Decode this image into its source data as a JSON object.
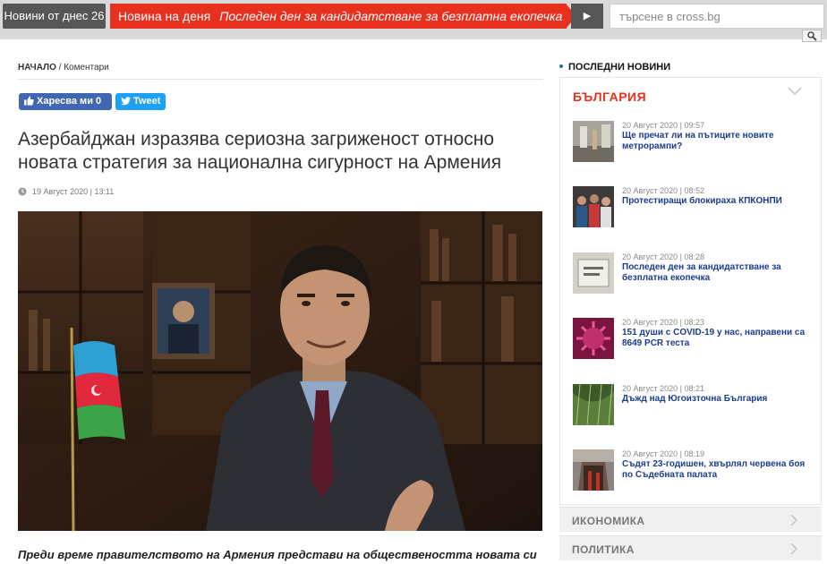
{
  "topbar": {
    "today_label": "Новини от днес 26",
    "news_day_label": "Новина на деня",
    "news_day_headline": "Последен ден за кандидатстване за безплатна екопечка",
    "next_symbol": "▶",
    "search_placeholder": "търсене в cross.bg"
  },
  "breadcrumb": {
    "home": "НАЧАЛО",
    "separator": " / ",
    "section": "Коментари"
  },
  "social": {
    "facebook_label": "Харесва ми 0",
    "twitter_label": "Tweet"
  },
  "article": {
    "title": "Азербайджан изразява сериозна загриженост относно новата стратегия за национална сигурност на Армения",
    "date": "19 Август 2020 | 13:11",
    "lead": "Преди време правителството на Армения представи на обществеността новата си"
  },
  "sidebar": {
    "heading": "ПОСЛЕДНИ НОВИНИ",
    "category": "БЪЛГАРИЯ",
    "items": [
      {
        "meta": "20 Август 2020 | 09:57",
        "title": "Ще пречат ли на пътиците новите метрорампи?"
      },
      {
        "meta": "20 Август 2020 | 08:52",
        "title": "Протестиращи блокираха КПКОНПИ"
      },
      {
        "meta": "20 Август 2020 | 08:28",
        "title": "Последен ден за кандидатстване за безплатна екопечка"
      },
      {
        "meta": "20 Август 2020 | 08:23",
        "title": "151 души с COVID-19 у нас, направени са 8649 PCR теста"
      },
      {
        "meta": "20 Август 2020 | 08:21",
        "title": "Дъжд над Югоизточна България"
      },
      {
        "meta": "20 Август 2020 | 08:19",
        "title": "Съдят 23-годишен, хвърлял червена боя по Съдебната палата"
      }
    ],
    "more_categories": [
      "ИКОНОМИКА",
      "ПОЛИТИКА"
    ]
  },
  "colors": {
    "accent": "#e8301f",
    "dark": "#565656",
    "link": "#1a3c8c"
  }
}
